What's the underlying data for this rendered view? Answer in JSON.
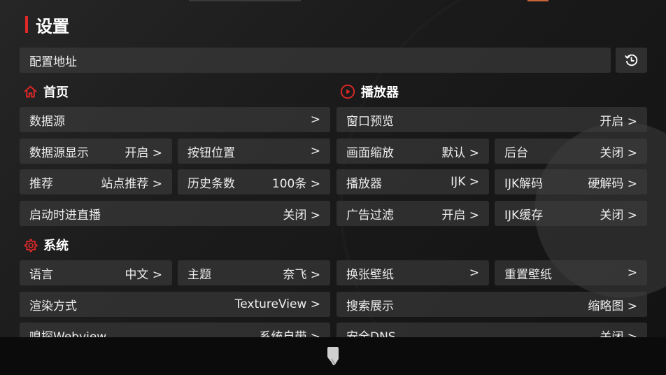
{
  "title": "设置",
  "config": {
    "label": "配置地址"
  },
  "sections": {
    "home": "首页",
    "player": "播放器",
    "system": "系统"
  },
  "items": {
    "data_source": {
      "label": "数据源",
      "value": ">"
    },
    "data_source_display": {
      "label": "数据源显示",
      "value": "开启 >"
    },
    "button_position": {
      "label": "按钮位置",
      "value": ">"
    },
    "recommend": {
      "label": "推荐",
      "value": "站点推荐 >"
    },
    "history_count": {
      "label": "历史条数",
      "value": "100条 >"
    },
    "startup_live": {
      "label": "启动时进直播",
      "value": "关闭 >"
    },
    "window_preview": {
      "label": "窗口预览",
      "value": "开启 >"
    },
    "screen_scale": {
      "label": "画面缩放",
      "value": "默认 >"
    },
    "background": {
      "label": "后台",
      "value": "关闭 >"
    },
    "player": {
      "label": "播放器",
      "value": "IJK >"
    },
    "ijk_decode": {
      "label": "IJK解码",
      "value": "硬解码 >"
    },
    "ad_filter": {
      "label": "广告过滤",
      "value": "开启 >"
    },
    "ijk_cache": {
      "label": "IJK缓存",
      "value": "关闭 >"
    },
    "language": {
      "label": "语言",
      "value": "中文 >"
    },
    "theme": {
      "label": "主题",
      "value": "奈飞 >"
    },
    "change_wallpaper": {
      "label": "换张壁纸",
      "value": ">"
    },
    "reset_wallpaper": {
      "label": "重置壁纸",
      "value": ">"
    },
    "render_mode": {
      "label": "渲染方式",
      "value": "TextureView >"
    },
    "search_display": {
      "label": "搜索展示",
      "value": "缩略图 >"
    },
    "sniff_webview": {
      "label": "嗅探Webview",
      "value": "系统自带 >"
    },
    "secure_dns": {
      "label": "安全DNS",
      "value": "关闭 >"
    }
  },
  "colors": {
    "accent": "#e02828"
  },
  "icons": {
    "history": "history-icon",
    "home": "home-icon",
    "play": "play-circle-icon",
    "settings": "gear-icon"
  }
}
